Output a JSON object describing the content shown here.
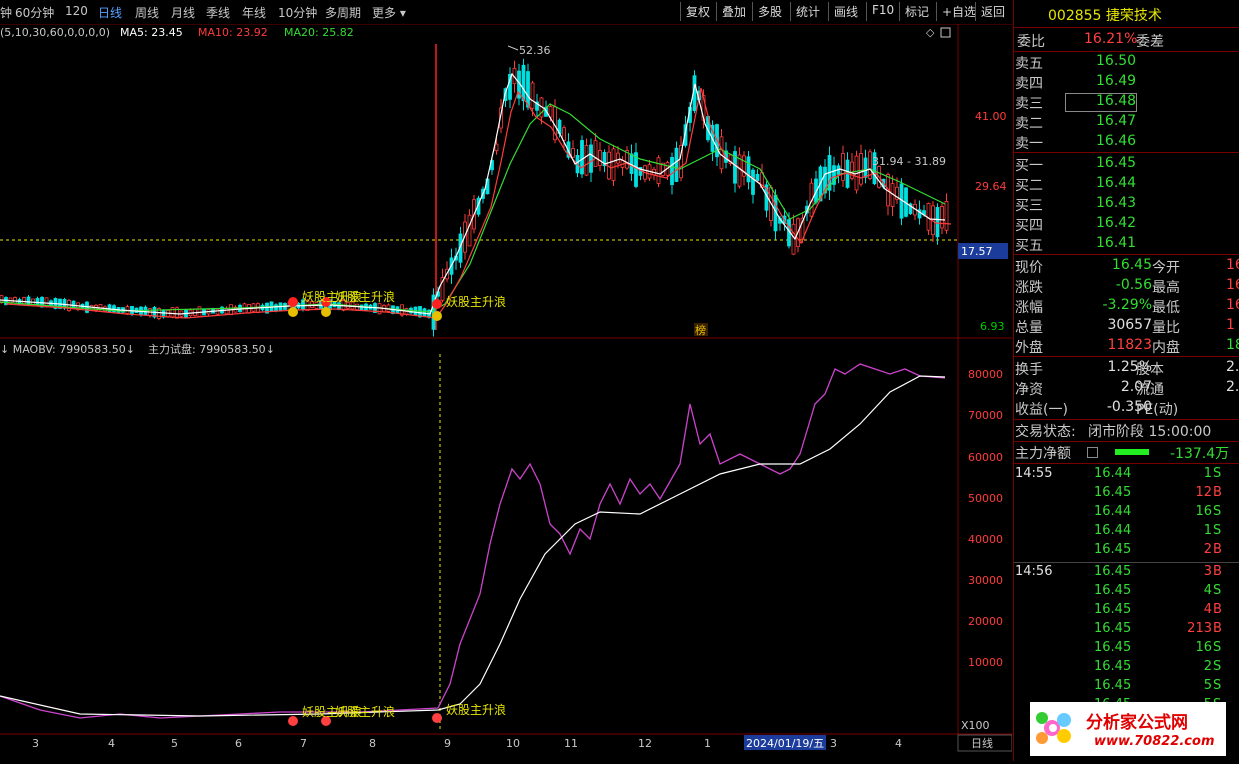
{
  "toolbar": {
    "periods": [
      "钟",
      "60分钟",
      "120",
      "日线",
      "周线",
      "月线",
      "季线",
      "年线",
      "10分钟",
      "多周期",
      "更多"
    ],
    "active_period": "日线",
    "buttons": [
      "复权",
      "叠加",
      "多股",
      "统计",
      "画线",
      "F10",
      "标记",
      "+自选",
      "返回"
    ]
  },
  "main_chart": {
    "indicator_label": "(5,10,30,60,0,0,0,0)",
    "ma5": "MA5: 23.45",
    "ma10": "MA10: 23.92",
    "ma20": "MA20: 25.82",
    "high_label": "52.36",
    "range_label": "31.94 - 31.89",
    "signal_labels": [
      "妖股主升浪",
      "妖股主升浪",
      "妖股主升浪"
    ],
    "marker_label": "榜",
    "price_axis": [
      "41.00",
      "29.64",
      "17.57",
      "6.93"
    ],
    "current_price_tag": "17.57"
  },
  "sub_chart": {
    "maobv": "MAOBV: 7990583.50",
    "zhuli": "主力试盘: 7990583.50",
    "signal_labels": [
      "妖股主升浪",
      "妖股主升浪",
      "妖股主升浪"
    ],
    "axis": [
      "80000",
      "70000",
      "60000",
      "50000",
      "40000",
      "30000",
      "20000",
      "10000"
    ],
    "multiplier": "X100"
  },
  "time_axis": {
    "labels": [
      "3",
      "4",
      "5",
      "6",
      "7",
      "8",
      "9",
      "10",
      "11",
      "12",
      "1",
      "3",
      "4"
    ],
    "highlight_date": "2024/01/19/五",
    "period_btn": "日线"
  },
  "colors": {
    "rise": "#ff3c3c",
    "fall": "#00ffff",
    "ma5": "#ffffff",
    "ma10": "#ff3c3c",
    "ma20": "#33dd33",
    "obv": "#cc44cc"
  },
  "stock": {
    "code": "002855",
    "name": "捷荣技术"
  },
  "weibi": {
    "label": "委比",
    "value": "16.21%",
    "label2": "委差"
  },
  "sell_orders": [
    {
      "label": "卖五",
      "price": "16.50"
    },
    {
      "label": "卖四",
      "price": "16.49"
    },
    {
      "label": "卖三",
      "price": "16.48"
    },
    {
      "label": "卖二",
      "price": "16.47"
    },
    {
      "label": "卖一",
      "price": "16.46"
    }
  ],
  "buy_orders": [
    {
      "label": "买一",
      "price": "16.45"
    },
    {
      "label": "买二",
      "price": "16.44"
    },
    {
      "label": "买三",
      "price": "16.43"
    },
    {
      "label": "买四",
      "price": "16.42"
    },
    {
      "label": "买五",
      "price": "16.41"
    }
  ],
  "quote": [
    {
      "label": "现价",
      "value": "16.45",
      "label2": "今开",
      "value2": "16"
    },
    {
      "label": "涨跌",
      "value": "-0.56",
      "label2": "最高",
      "value2": "16"
    },
    {
      "label": "涨幅",
      "value": "-3.29%",
      "label2": "最低",
      "value2": "16"
    },
    {
      "label": "总量",
      "value": "30657",
      "label2": "量比",
      "value2": "1"
    },
    {
      "label": "外盘",
      "value": "11823",
      "label2": "内盘",
      "value2": "18"
    }
  ],
  "fundamentals": [
    {
      "label": "换手",
      "value": "1.25%",
      "label2": "股本",
      "value2": "2.4"
    },
    {
      "label": "净资",
      "value": "2.07",
      "label2": "流通",
      "value2": "2.4"
    },
    {
      "label": "收益(一)",
      "value": "-0.350",
      "label2": "PE(动)",
      "value2": ""
    }
  ],
  "trade_status": {
    "label": "交易状态:",
    "value": "闭市阶段 15:00:00"
  },
  "net_flow": {
    "label": "主力净额",
    "value": "-137.4万"
  },
  "ticks": [
    {
      "time": "14:55",
      "price": "16.44",
      "vol": "1",
      "bs": "S"
    },
    {
      "time": "",
      "price": "16.45",
      "vol": "12",
      "bs": "B"
    },
    {
      "time": "",
      "price": "16.44",
      "vol": "16",
      "bs": "S"
    },
    {
      "time": "",
      "price": "16.44",
      "vol": "1",
      "bs": "S"
    },
    {
      "time": "",
      "price": "16.45",
      "vol": "2",
      "bs": "B"
    },
    {
      "time": "14:56",
      "price": "16.45",
      "vol": "3",
      "bs": "B"
    },
    {
      "time": "",
      "price": "16.45",
      "vol": "4",
      "bs": "S"
    },
    {
      "time": "",
      "price": "16.45",
      "vol": "4",
      "bs": "B"
    },
    {
      "time": "",
      "price": "16.45",
      "vol": "213",
      "bs": "B"
    },
    {
      "time": "",
      "price": "16.45",
      "vol": "16",
      "bs": "S"
    },
    {
      "time": "",
      "price": "16.45",
      "vol": "2",
      "bs": "S"
    },
    {
      "time": "",
      "price": "16.45",
      "vol": "5",
      "bs": "S"
    },
    {
      "time": "",
      "price": "16.45",
      "vol": "5",
      "bs": "S"
    }
  ],
  "logo": {
    "text": "分析家公式网",
    "url_text": "www.70822.com"
  }
}
